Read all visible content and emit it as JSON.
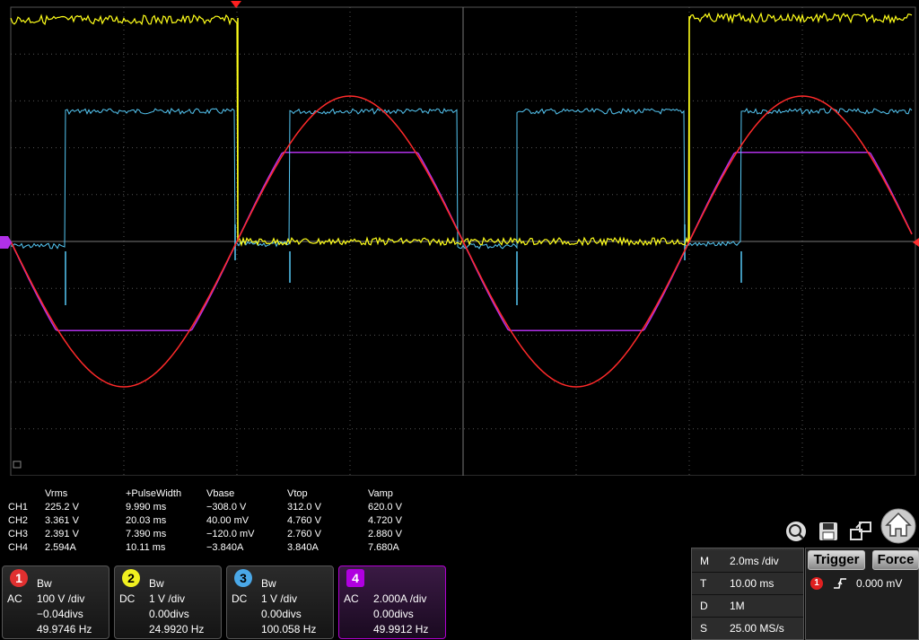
{
  "measurements": {
    "headers": [
      "Vrms",
      "+PulseWidth",
      "Vbase",
      "Vtop",
      "Vamp"
    ],
    "rows": [
      {
        "ch": "CH1",
        "values": [
          "225.2 V",
          "9.990 ms",
          "−308.0 V",
          "312.0 V",
          "620.0 V"
        ]
      },
      {
        "ch": "CH2",
        "values": [
          "3.361 V",
          "20.03 ms",
          "40.00 mV",
          "4.760 V",
          "4.720 V"
        ]
      },
      {
        "ch": "CH3",
        "values": [
          "2.391 V",
          "7.390 ms",
          "−120.0 mV",
          "2.760 V",
          "2.880 V"
        ]
      },
      {
        "ch": "CH4",
        "values": [
          "2.594A",
          "10.11 ms",
          "−3.840A",
          "3.840A",
          "7.680A"
        ]
      }
    ]
  },
  "channels": [
    {
      "num": "1",
      "bw": "Bw",
      "coupling": "AC",
      "scale": "100 V /div",
      "offset": "−0.04divs",
      "freq": "49.9746 Hz",
      "color": "#ff3030"
    },
    {
      "num": "2",
      "bw": "Bw",
      "coupling": "DC",
      "scale": "1 V /div",
      "offset": "0.00divs",
      "freq": "24.9920 Hz",
      "color": "#ffff20"
    },
    {
      "num": "3",
      "bw": "Bw",
      "coupling": "DC",
      "scale": "1 V /div",
      "offset": "0.00divs",
      "freq": "100.058 Hz",
      "color": "#5ab4f0"
    },
    {
      "num": "4",
      "bw": "",
      "coupling": "AC",
      "scale": "2.000A /div",
      "offset": "0.00divs",
      "freq": "49.9912 Hz",
      "color": "#c000ff"
    }
  ],
  "horizontal": {
    "m_label": "M",
    "m_value": "2.0ms /div",
    "t_label": "T",
    "t_value": "10.00 ms",
    "d_label": "D",
    "d_value": "1M",
    "s_label": "S",
    "s_value": "25.00 MS/s"
  },
  "trigger": {
    "trigger_label": "Trigger",
    "force_label": "Force",
    "source": "1",
    "level": "0.000 mV"
  },
  "colors": {
    "ch1": "#ff2a2a",
    "ch2": "#ffff1a",
    "ch3": "#55c8f5",
    "ch4": "#b030e8",
    "grid": "#555555",
    "trigger_marker": "#ff0000"
  },
  "icons": [
    "search-zoom-icon",
    "save-icon",
    "export-icon",
    "home-icon"
  ]
}
